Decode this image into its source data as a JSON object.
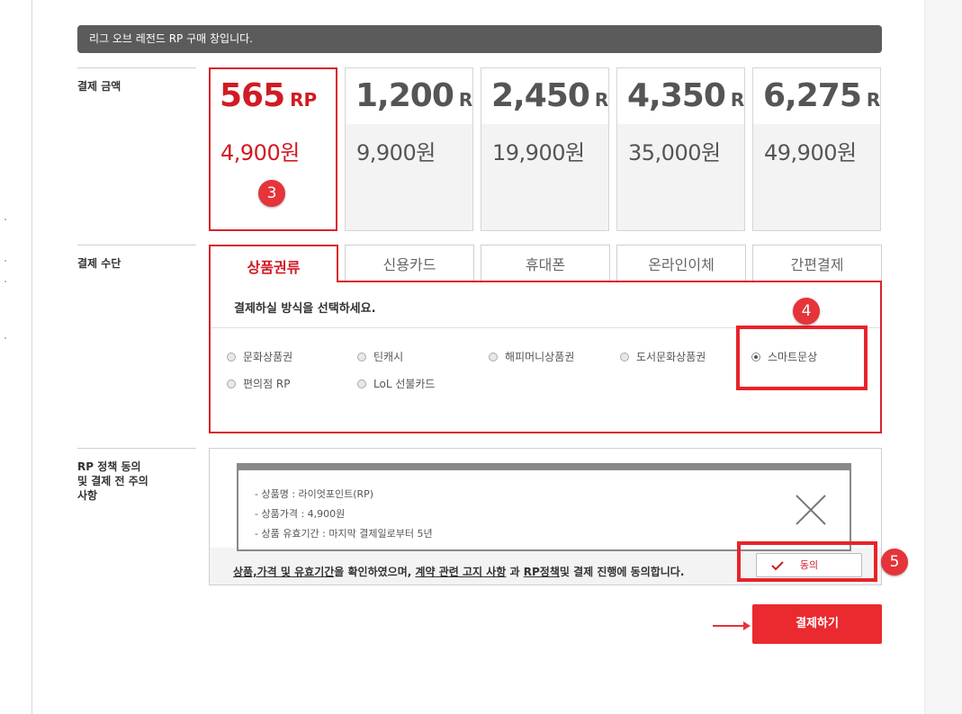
{
  "banner": {
    "text": "리그 오브 레전드 RP 구매 창입니다."
  },
  "amount": {
    "label": "결제 금액",
    "cards": [
      {
        "rp": "565",
        "unit": "RP",
        "price": "4,900원",
        "selected": true
      },
      {
        "rp": "1,200",
        "unit": "RP",
        "price": "9,900원",
        "selected": false
      },
      {
        "rp": "2,450",
        "unit": "RP",
        "price": "19,900원",
        "selected": false
      },
      {
        "rp": "4,350",
        "unit": "RP",
        "price": "35,000원",
        "selected": false
      },
      {
        "rp": "6,275",
        "unit": "RP",
        "price": "49,900원",
        "selected": false
      }
    ]
  },
  "method": {
    "label": "결제 수단",
    "tabs": [
      "상품권류",
      "신용카드",
      "휴대폰",
      "온라인이체",
      "간편결제"
    ],
    "active_tab": "상품권류",
    "prompt": "결제하실 방식을 선택하세요.",
    "options": [
      "문화상품권",
      "틴캐시",
      "해피머니상품권",
      "도서문화상품권",
      "스마트문상",
      "편의점 RP",
      "LoL 선불카드"
    ],
    "selected_option": "스마트문상"
  },
  "policy": {
    "label": "RP 정책 동의 및 결제 전 주의 사항",
    "label_lines": [
      "RP 정책 동의",
      "및 결제 전 주의",
      "사항"
    ],
    "popup_lines": [
      "- 상품명 : 라이엇포인트(RP)",
      "- 상품가격 : 4,900원",
      "- 상품 유효기간 : 마지막 결제일로부터 5년"
    ],
    "agree_parts": {
      "a": "상품,가격 및 유효기간",
      "b": "을 확인하였으며, ",
      "c": "계약 관련 고지 사항",
      "d": " 과 ",
      "e": "RP정책",
      "f": "및 결제 진행에 동의합니다."
    },
    "agree_button": "동의"
  },
  "pay_button": "결제하기",
  "markers": {
    "m3": "3",
    "m4": "4",
    "m5": "5"
  },
  "colors": {
    "accent": "#ea2a2f",
    "selected_text": "#d01b24",
    "banner_bg": "#5b5b5b"
  }
}
